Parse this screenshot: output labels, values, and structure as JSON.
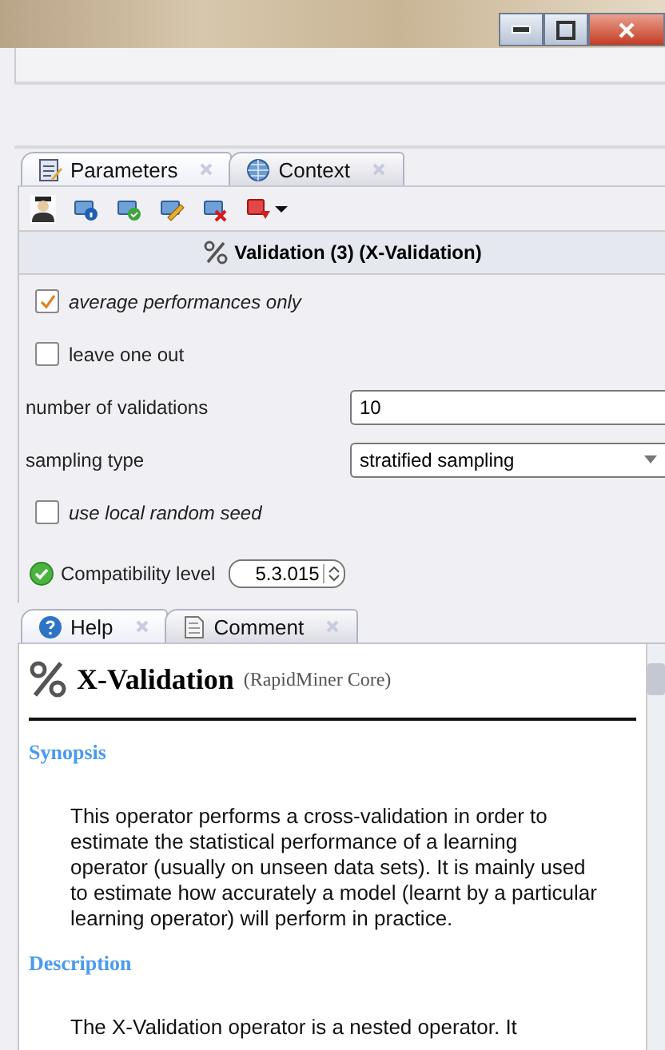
{
  "window": {
    "controls": [
      {
        "kind": "minimize"
      },
      {
        "kind": "restore"
      },
      {
        "kind": "close"
      }
    ]
  },
  "top_tabs": [
    {
      "label": "Parameters",
      "kind": "parameters",
      "selected": true
    },
    {
      "label": "Context",
      "kind": "context",
      "selected": false
    }
  ],
  "toolbar": [
    {
      "kind": "expert"
    },
    {
      "kind": "info"
    },
    {
      "kind": "check"
    },
    {
      "kind": "edit"
    },
    {
      "kind": "delete"
    },
    {
      "kind": "breakpoint"
    }
  ],
  "operator_title": "Validation (3) (X-Validation)",
  "parameters": [
    {
      "kind": "checkbox",
      "label": "average performances only",
      "checked": true,
      "italic": true
    },
    {
      "kind": "checkbox",
      "label": "leave one out",
      "checked": false,
      "italic": false
    },
    {
      "kind": "text",
      "label": "number of validations",
      "value": "10"
    },
    {
      "kind": "select",
      "label": "sampling type",
      "value": "stratified sampling"
    },
    {
      "kind": "checkbox",
      "label": "use local random seed",
      "checked": false,
      "italic": true
    }
  ],
  "compatibility": {
    "label": "Compatibility level",
    "value": "5.3.015"
  },
  "bottom_tabs": [
    {
      "label": "Help",
      "kind": "help",
      "selected": true
    },
    {
      "label": "Comment",
      "kind": "comment",
      "selected": false
    }
  ],
  "help": {
    "title": "X-Validation",
    "subtitle": "(RapidMiner Core)",
    "sections": [
      {
        "heading": "Synopsis",
        "text": "This operator performs a cross-validation in order to estimate the statistical performance of a learning operator (usually on unseen data sets). It is mainly used to estimate how accurately a model (learnt by a particular learning operator) will perform in practice."
      },
      {
        "heading": "Description",
        "text": "The X-Validation operator is a nested operator. It"
      }
    ]
  }
}
